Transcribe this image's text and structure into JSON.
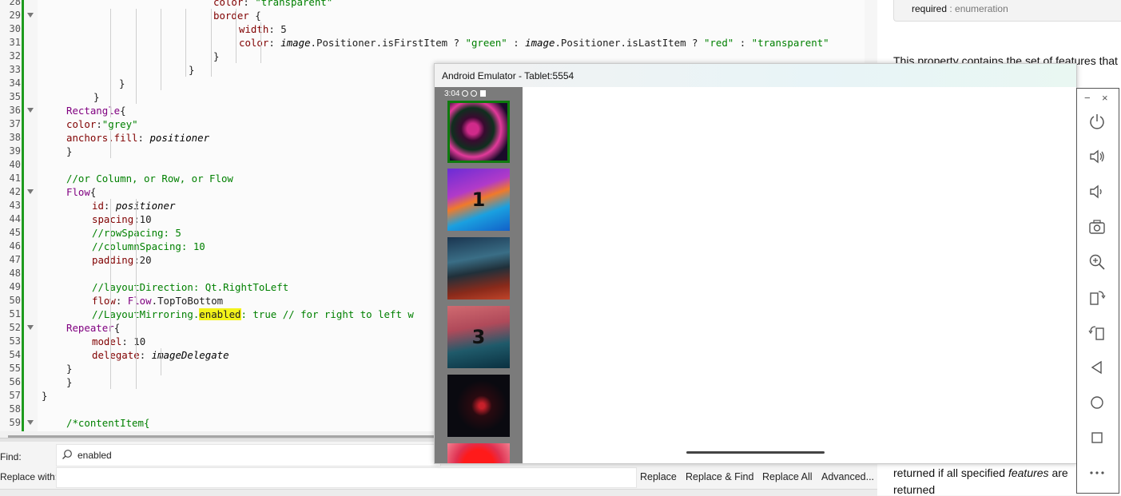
{
  "editor": {
    "lines": [
      {
        "n": "28",
        "fold": false,
        "parts": [
          [
            "color",
            "p"
          ],
          [
            ": ",
            ""
          ],
          [
            "\"transparent\"",
            "s"
          ]
        ]
      },
      {
        "n": "29",
        "fold": true,
        "parts": [
          [
            "border",
            "p"
          ],
          [
            " {",
            ""
          ]
        ]
      },
      {
        "n": "30",
        "fold": false,
        "parts": [
          [
            "width",
            "p"
          ],
          [
            ": 5",
            ""
          ]
        ]
      },
      {
        "n": "31",
        "fold": false,
        "parts": [
          [
            "color",
            "p"
          ],
          [
            ": ",
            ""
          ],
          [
            "image",
            "i"
          ],
          [
            ".Positioner.isFirstItem ? ",
            ""
          ],
          [
            "\"green\"",
            "s"
          ],
          [
            " : ",
            ""
          ],
          [
            "image",
            "i"
          ],
          [
            ".Positioner.isLastItem ? ",
            ""
          ],
          [
            "\"red\"",
            "s"
          ],
          [
            " : ",
            ""
          ],
          [
            "\"transparent\"",
            "s"
          ]
        ]
      },
      {
        "n": "32",
        "fold": false,
        "parts": [
          [
            "}",
            ""
          ]
        ]
      },
      {
        "n": "33",
        "fold": false,
        "parts": [
          [
            "}",
            ""
          ]
        ]
      },
      {
        "n": "34",
        "fold": false,
        "parts": [
          [
            "}",
            ""
          ]
        ]
      },
      {
        "n": "35",
        "fold": false,
        "parts": [
          [
            "}",
            ""
          ]
        ]
      },
      {
        "n": "36",
        "fold": true,
        "parts": [
          [
            "Rectangle",
            "k"
          ],
          [
            "{",
            ""
          ]
        ]
      },
      {
        "n": "37",
        "fold": false,
        "parts": [
          [
            "color",
            "p"
          ],
          [
            ":",
            ""
          ],
          [
            "\"grey\"",
            "s"
          ]
        ]
      },
      {
        "n": "38",
        "fold": false,
        "parts": [
          [
            "anchors.fill",
            "p"
          ],
          [
            ": ",
            ""
          ],
          [
            "positioner",
            "i"
          ]
        ]
      },
      {
        "n": "39",
        "fold": false,
        "parts": [
          [
            "}",
            ""
          ]
        ]
      },
      {
        "n": "40",
        "fold": false,
        "parts": []
      },
      {
        "n": "41",
        "fold": false,
        "parts": [
          [
            "//or Column, or Row, or Flow",
            "c"
          ]
        ]
      },
      {
        "n": "42",
        "fold": true,
        "parts": [
          [
            "Flow",
            "k"
          ],
          [
            "{",
            ""
          ]
        ]
      },
      {
        "n": "43",
        "fold": false,
        "parts": [
          [
            "id",
            "p"
          ],
          [
            ": ",
            ""
          ],
          [
            "positioner",
            "i"
          ]
        ]
      },
      {
        "n": "44",
        "fold": false,
        "parts": [
          [
            "spacing",
            "p"
          ],
          [
            ":10",
            ""
          ]
        ]
      },
      {
        "n": "45",
        "fold": false,
        "parts": [
          [
            "//rowSpacing: 5",
            "c"
          ]
        ]
      },
      {
        "n": "46",
        "fold": false,
        "parts": [
          [
            "//columnSpacing: 10",
            "c"
          ]
        ]
      },
      {
        "n": "47",
        "fold": false,
        "parts": [
          [
            "padding",
            "p"
          ],
          [
            ":20",
            ""
          ]
        ]
      },
      {
        "n": "48",
        "fold": false,
        "parts": []
      },
      {
        "n": "49",
        "fold": false,
        "parts": [
          [
            "//layoutDirection: Qt.RightToLeft",
            "c"
          ]
        ]
      },
      {
        "n": "50",
        "fold": false,
        "parts": [
          [
            "flow",
            "p"
          ],
          [
            ": ",
            ""
          ],
          [
            "Flow",
            "k"
          ],
          [
            ".TopToBottom",
            ""
          ]
        ]
      },
      {
        "n": "51",
        "fold": false,
        "parts": [
          [
            "//LayoutMirroring.",
            "c"
          ],
          [
            "enabled",
            "hl"
          ],
          [
            ": true // for right to left w",
            "c"
          ]
        ]
      },
      {
        "n": "52",
        "fold": true,
        "parts": [
          [
            "Repeater",
            "k"
          ],
          [
            "{",
            ""
          ]
        ]
      },
      {
        "n": "53",
        "fold": false,
        "parts": [
          [
            "model",
            "p"
          ],
          [
            ": 10",
            ""
          ]
        ]
      },
      {
        "n": "54",
        "fold": false,
        "parts": [
          [
            "delegate",
            "p"
          ],
          [
            ": ",
            ""
          ],
          [
            "imageDelegate",
            "i"
          ]
        ]
      },
      {
        "n": "55",
        "fold": false,
        "parts": [
          [
            "}",
            ""
          ]
        ]
      },
      {
        "n": "56",
        "fold": false,
        "parts": [
          [
            "}",
            ""
          ]
        ]
      },
      {
        "n": "57",
        "fold": false,
        "parts": [
          [
            "}",
            ""
          ]
        ]
      },
      {
        "n": "58",
        "fold": false,
        "parts": []
      },
      {
        "n": "59",
        "fold": true,
        "parts": [
          [
            "/*contentItem{",
            "c"
          ]
        ]
      }
    ]
  },
  "find": {
    "find_label": "Find:",
    "replace_label": "Replace with:",
    "find_value": "enabled",
    "buttons": [
      "Replace",
      "Replace & Find",
      "Replace All",
      "Advanced..."
    ]
  },
  "doc": {
    "required_label": "required",
    "required_type": " : enumeration",
    "text1": "This property contains the set of features that",
    "text2_a": "returned if all specified ",
    "text2_b": "features",
    "text2_c": " are",
    "text3": "returned"
  },
  "emulator": {
    "title": "Android Emulator - Tablet:5554",
    "status_time": "3:04",
    "thumb_numbers": [
      "",
      "1",
      "",
      "3",
      "",
      ""
    ],
    "toolbar": [
      "power-icon",
      "volume-up-icon",
      "volume-down-icon",
      "camera-icon",
      "zoom-icon",
      "rotate-left-icon",
      "rotate-right-icon",
      "back-icon",
      "home-icon",
      "overview-icon",
      "more-icon"
    ],
    "minimize": "−",
    "close": "×"
  },
  "colors": {
    "accent_green": "#1e9b1e",
    "highlight": "#f3f31a"
  }
}
